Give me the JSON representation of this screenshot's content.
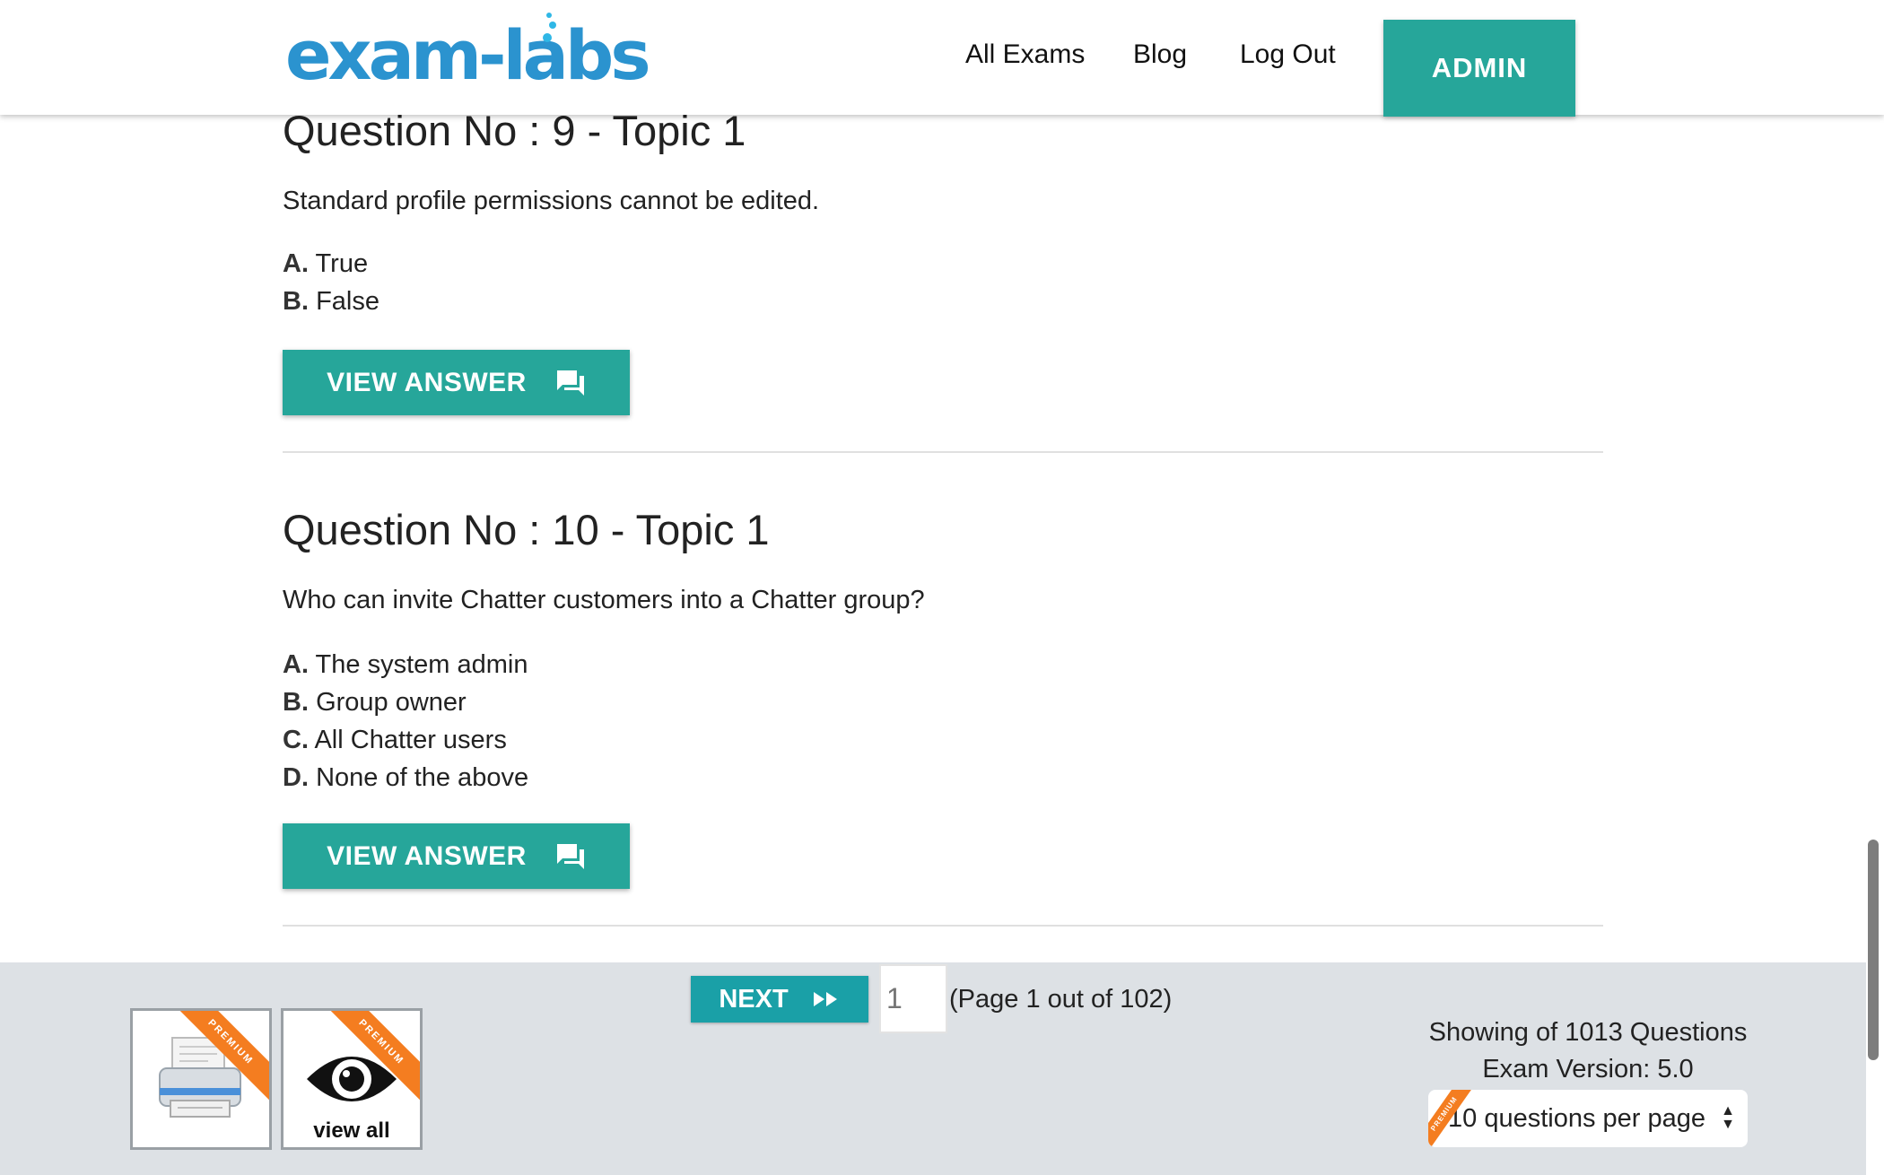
{
  "header": {
    "logo": "exam-labs",
    "nav": [
      "All Exams",
      "Blog",
      "Log Out"
    ],
    "admin_label": "ADMIN"
  },
  "questions": [
    {
      "title": "Question No : 9 - Topic 1",
      "text": "Standard profile permissions cannot be edited.",
      "options": [
        {
          "letter": "A.",
          "text": "True"
        },
        {
          "letter": "B.",
          "text": "False"
        }
      ],
      "button": "VIEW ANSWER"
    },
    {
      "title": "Question No : 10 - Topic 1",
      "text": "Who can invite Chatter customers into a Chatter group?",
      "options": [
        {
          "letter": "A.",
          "text": "The system admin"
        },
        {
          "letter": "B.",
          "text": "Group owner"
        },
        {
          "letter": "C.",
          "text": "All Chatter users"
        },
        {
          "letter": "D.",
          "text": "None of the above"
        }
      ],
      "button": "VIEW ANSWER"
    }
  ],
  "footer": {
    "premium_label": "PREMIUM",
    "view_all_label": "view all",
    "next_label": "NEXT",
    "page_placeholder": "1",
    "page_info": "(Page 1 out of 102)",
    "showing": "Showing of 1013 Questions",
    "version": "Exam Version: 5.0",
    "per_page": "10 questions per page"
  },
  "colors": {
    "accent": "#26a69a",
    "next": "#1aa0a7",
    "logo": "#2b93cf",
    "ribbon": "#f47d20",
    "footer_bg": "#dde1e5"
  },
  "icons": [
    "chat-icon",
    "fast-forward-icon",
    "printer-icon",
    "eye-icon",
    "select-arrows-icon"
  ]
}
